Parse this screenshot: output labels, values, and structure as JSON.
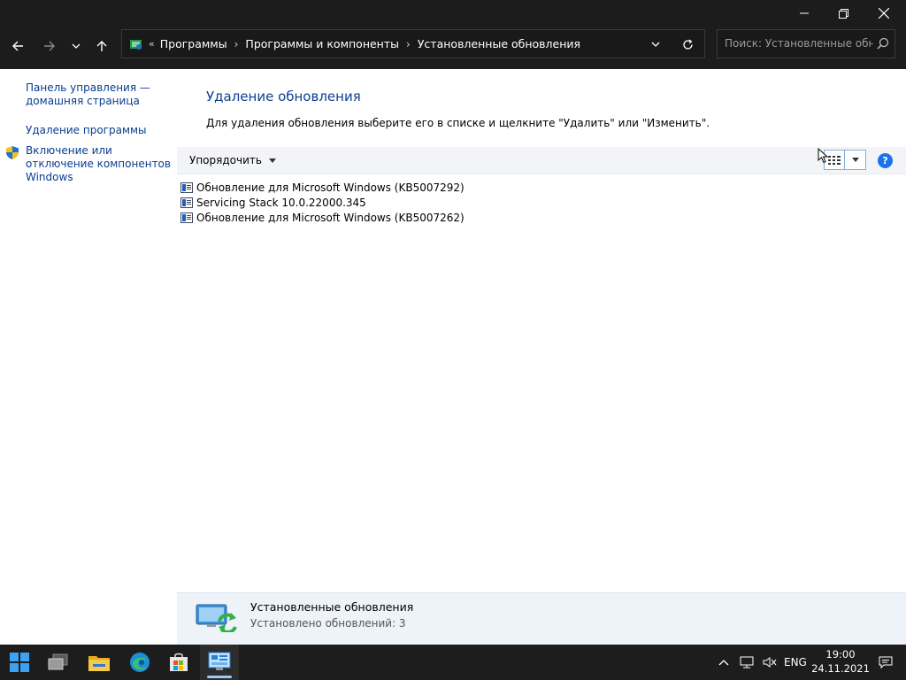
{
  "titlebar": {
    "minimize_icon": "minimize-icon",
    "maximize_icon": "restore-icon",
    "close_icon": "close-icon"
  },
  "nav": {
    "back_icon": "arrow-left-icon",
    "forward_icon": "arrow-right-icon",
    "recent_icon": "chevron-down-icon",
    "up_icon": "arrow-up-icon"
  },
  "address": {
    "overflow": "«",
    "crumbs": [
      "Программы",
      "Программы и компоненты",
      "Установленные обновления"
    ],
    "separator": "›"
  },
  "search": {
    "placeholder": "Поиск: Установленные обно..."
  },
  "left_pane": {
    "home_link": "Панель управления — домашняя страница",
    "uninstall_link": "Удаление программы",
    "features_link": "Включение или отключение компонентов Windows"
  },
  "main": {
    "title": "Удаление обновления",
    "description": "Для удаления обновления выберите его в списке и щелкните \"Удалить\" или \"Изменить\".",
    "organize_label": "Упорядочить",
    "help_label": "?"
  },
  "updates": [
    {
      "name": "Обновление для Microsoft Windows (KB5007292)"
    },
    {
      "name": "Servicing Stack 10.0.22000.345"
    },
    {
      "name": "Обновление для Microsoft Windows (KB5007262)"
    }
  ],
  "details": {
    "title": "Установленные обновления",
    "subtitle": "Установлено обновлений: 3"
  },
  "taskbar": {
    "language": "ENG",
    "time": "19:00",
    "date": "24.11.2021"
  },
  "colors": {
    "link": "#0a3d8f",
    "title_blue": "#0e3f90",
    "dark_chrome": "#1c1c1c",
    "accent": "#1a73e8"
  }
}
